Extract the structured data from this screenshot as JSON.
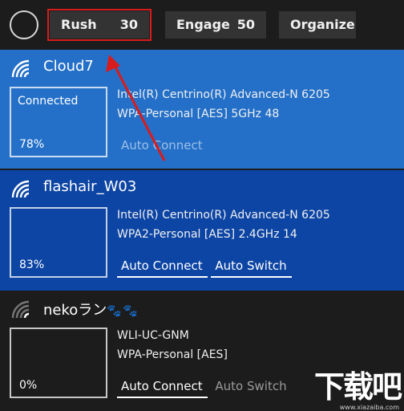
{
  "toolbar": {
    "rush": {
      "label": "Rush",
      "value": "30"
    },
    "engage": {
      "label": "Engage",
      "value": "50"
    },
    "organize": {
      "label": "Organize"
    }
  },
  "networks": [
    {
      "ssid": "Cloud7",
      "status": "Connected",
      "signal": "78%",
      "adapter": "Intel(R) Centrino(R) Advanced-N 6205",
      "details": "WPA-Personal [AES] 5GHz 48",
      "options": [
        {
          "label": "Auto Connect",
          "enabled": false
        }
      ]
    },
    {
      "ssid": "flashair_W03",
      "status": "",
      "signal": "83%",
      "adapter": "Intel(R) Centrino(R) Advanced-N 6205",
      "details": "WPA2-Personal [AES] 2.4GHz 14",
      "options": [
        {
          "label": "Auto Connect",
          "enabled": true
        },
        {
          "label": "Auto Switch",
          "enabled": true
        }
      ]
    },
    {
      "ssid": "nekoラン",
      "ssid_suffix": "🐾🐾",
      "status": "",
      "signal": "0%",
      "adapter": "WLI-UC-GNM",
      "details": "WPA-Personal [AES]",
      "options": [
        {
          "label": "Auto Connect",
          "enabled": true
        },
        {
          "label": "Auto Switch",
          "enabled": false
        }
      ]
    }
  ],
  "colors": {
    "connected_row": "#2470c8",
    "available_row": "#0d45a4",
    "weak_row": "#1c1c1c",
    "highlight": "#d81c1c"
  },
  "watermark": {
    "text": "下载吧",
    "url": "www.xiazaiba.com"
  }
}
